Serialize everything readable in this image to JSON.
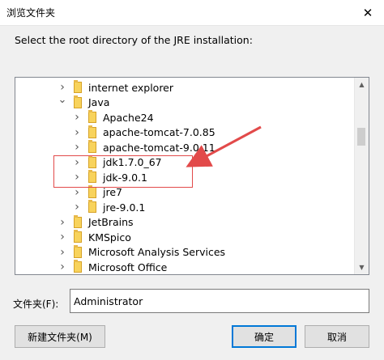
{
  "window": {
    "title": "浏览文件夹",
    "close_symbol": "✕"
  },
  "instruction": "Select the root directory of the JRE installation:",
  "tree": [
    {
      "label": "internet explorer",
      "level": 1,
      "expanded": false
    },
    {
      "label": "Java",
      "level": 1,
      "expanded": true
    },
    {
      "label": "Apache24",
      "level": 2,
      "expanded": false
    },
    {
      "label": "apache-tomcat-7.0.85",
      "level": 2,
      "expanded": false
    },
    {
      "label": "apache-tomcat-9.0.11",
      "level": 2,
      "expanded": false
    },
    {
      "label": "jdk1.7.0_67",
      "level": 2,
      "expanded": false
    },
    {
      "label": "jdk-9.0.1",
      "level": 2,
      "expanded": false
    },
    {
      "label": "jre7",
      "level": 2,
      "expanded": false
    },
    {
      "label": "jre-9.0.1",
      "level": 2,
      "expanded": false
    },
    {
      "label": "JetBrains",
      "level": 1,
      "expanded": false
    },
    {
      "label": "KMSpico",
      "level": 1,
      "expanded": false
    },
    {
      "label": "Microsoft Analysis Services",
      "level": 1,
      "expanded": false
    },
    {
      "label": "Microsoft Office",
      "level": 1,
      "expanded": false
    }
  ],
  "folder_field": {
    "label": "文件夹(F):",
    "value": "Administrator"
  },
  "buttons": {
    "new_folder": "新建文件夹(M)",
    "ok": "确定",
    "cancel": "取消"
  },
  "colors": {
    "accent": "#0078d7",
    "annotation": "#e24a4a",
    "folder": "#f8d35c"
  },
  "icons": {
    "collapsed": "chevron-right-icon",
    "expanded": "chevron-down-icon",
    "folder": "folder-icon",
    "close": "close-icon"
  }
}
